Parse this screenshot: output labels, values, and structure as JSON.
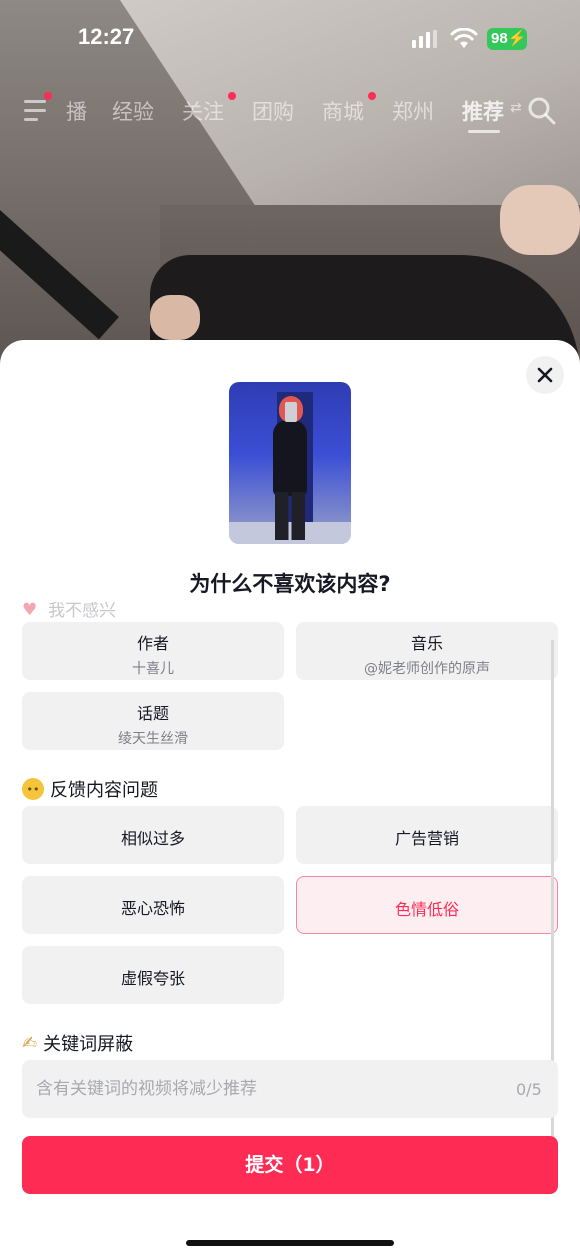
{
  "status_bar": {
    "time": "12:27",
    "battery": "98"
  },
  "nav": {
    "tabs": [
      {
        "label": "播",
        "dot": false
      },
      {
        "label": "经验",
        "dot": false
      },
      {
        "label": "关注",
        "dot": true
      },
      {
        "label": "团购",
        "dot": false
      },
      {
        "label": "商城",
        "dot": true
      },
      {
        "label": "郑州",
        "dot": false
      },
      {
        "label": "推荐",
        "dot": false,
        "active": true
      }
    ],
    "swap_symbol": "⇄"
  },
  "sheet": {
    "title": "为什么不喜欢该内容?",
    "partial_section_label": "我不感兴",
    "interest_options": [
      {
        "title": "作者",
        "subtitle": "十喜儿"
      },
      {
        "title": "音乐",
        "subtitle": "@妮老师创作的原声"
      },
      {
        "title": "话题",
        "subtitle": "绫天生丝滑"
      }
    ],
    "feedback_section_label": "反馈内容问题",
    "feedback_options": [
      {
        "title": "相似过多",
        "selected": false
      },
      {
        "title": "广告营销",
        "selected": false
      },
      {
        "title": "恶心恐怖",
        "selected": false
      },
      {
        "title": "色情低俗",
        "selected": true
      },
      {
        "title": "虚假夸张",
        "selected": false
      }
    ],
    "keyword_section_label": "关键词屏蔽",
    "keyword_input": {
      "placeholder": "含有关键词的视频将减少推荐",
      "value": "",
      "count": "0/5"
    },
    "submit_label": "提交（1）"
  },
  "colors": {
    "accent": "#fe2c55",
    "selected_bg": "#fdeef1",
    "option_bg": "#f1f1f2"
  }
}
